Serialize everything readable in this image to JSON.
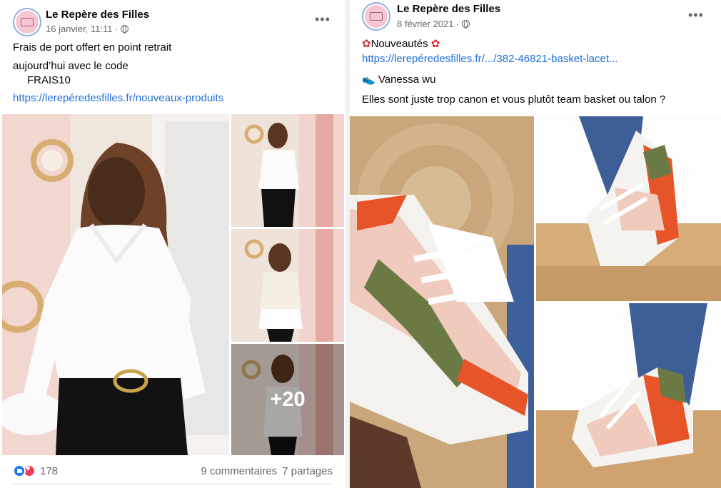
{
  "post1": {
    "page_name": "Le Repère des Filles",
    "date": "16 janvier, 11:11 ·",
    "text_lines": [
      "Frais de port offert  en point retrait",
      "aujourd’hui avec le code",
      "FRAIS10"
    ],
    "link": "https://lerepéredesfilles.fr/nouveaux-produits",
    "more_photos": "+20",
    "reaction_count": "178",
    "comments": "9 commentaires",
    "shares": "7 partages"
  },
  "post2": {
    "page_name": "Le Repère des Filles",
    "date": "8 février 2021 ·",
    "title": "Nouveautés",
    "link": "https://lerepéredesfilles.fr/.../382-46821-basket-lacet...",
    "model": "Vanessa wu",
    "caption": "Elles sont juste trop canon et vous plutôt team basket ou talon ?"
  },
  "icons": {
    "more": "more-options-icon",
    "globe": "globe-icon",
    "flower": "hibiscus-emoji",
    "shoe": "sneaker-emoji",
    "like": "like-reaction-icon",
    "love": "love-reaction-icon"
  },
  "colors": {
    "link": "#216fdb",
    "accent_pink": "#f7c6d3",
    "like_blue": "#1877f2",
    "love_red": "#f33e58"
  }
}
